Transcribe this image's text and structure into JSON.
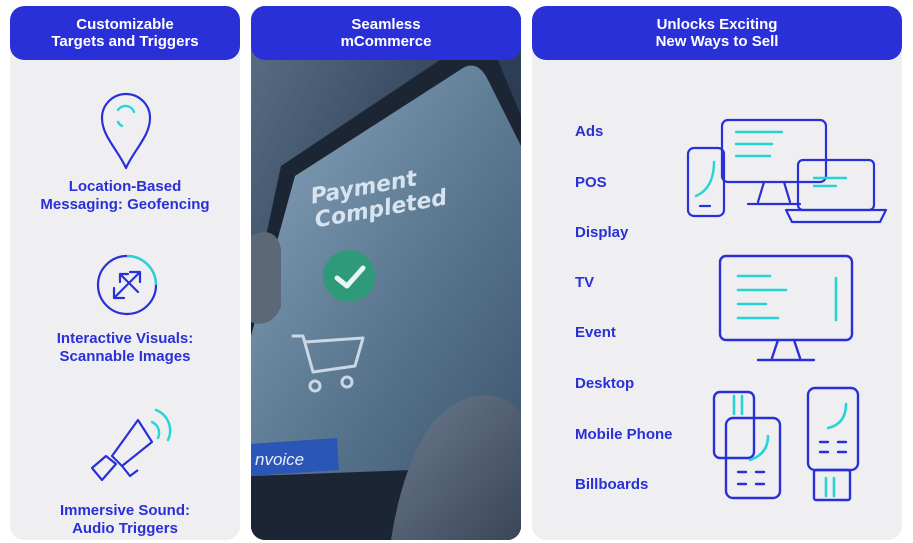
{
  "panels": {
    "targets": {
      "title": "Customizable\nTargets and Triggers",
      "features": [
        {
          "label": "Location-Based\nMessaging: Geofencing",
          "icon": "location-pin-icon"
        },
        {
          "label": "Interactive Visuals:\nScannable Images",
          "icon": "scan-arrows-icon"
        },
        {
          "label": "Immersive Sound:\nAudio Triggers",
          "icon": "megaphone-icon"
        }
      ]
    },
    "mcommerce": {
      "title": "Seamless\nmCommerce",
      "photo": {
        "screen_title": "Payment\nCompleted",
        "tag": "nvoice",
        "icons": [
          "check-icon",
          "cart-icon"
        ]
      }
    },
    "sell": {
      "title": "Unlocks Exciting\nNew Ways to Sell",
      "items": [
        "Ads",
        "POS",
        "Display",
        "TV",
        "Event",
        "Desktop",
        "Mobile Phone",
        "Billboards"
      ],
      "icons": [
        "multi-device-icon",
        "monitor-icon",
        "pos-terminals-icon"
      ]
    }
  },
  "colors": {
    "brand_blue": "#2a30d8",
    "accent_cyan": "#27d3d6",
    "panel_bg": "#efeff1"
  }
}
